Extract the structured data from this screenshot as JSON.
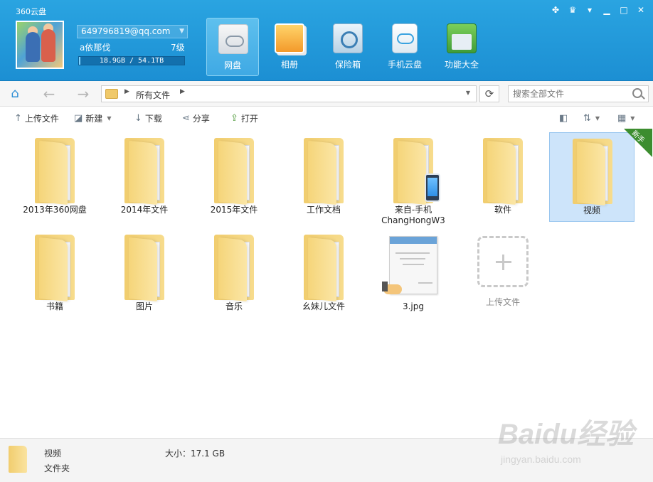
{
  "app": {
    "title": "360云盘"
  },
  "window_controls": [
    {
      "name": "gift-icon",
      "glyph": "✤"
    },
    {
      "name": "skin-icon",
      "glyph": "♛"
    },
    {
      "name": "menu-icon",
      "glyph": "▾"
    },
    {
      "name": "minimize-icon",
      "glyph": "▁"
    },
    {
      "name": "maximize-icon",
      "glyph": "□"
    },
    {
      "name": "close-icon",
      "glyph": "✕"
    }
  ],
  "user": {
    "account": "649796819@qq.com",
    "nickname": "a依那伐",
    "level": "7级",
    "quota_text": "18.9GB / 54.1TB",
    "quota_used_fraction": 0.0004
  },
  "nav_tabs": [
    {
      "id": "pan",
      "label": "网盘",
      "active": true
    },
    {
      "id": "album",
      "label": "相册",
      "active": false
    },
    {
      "id": "safe",
      "label": "保险箱",
      "active": false
    },
    {
      "id": "mobile",
      "label": "手机云盘",
      "active": false
    },
    {
      "id": "tools",
      "label": "功能大全",
      "active": false
    }
  ],
  "address": {
    "home_glyph": "⌂",
    "back_glyph": "←",
    "forward_glyph": "→",
    "crumb": "所有文件",
    "search_placeholder": "搜索全部文件"
  },
  "toolbar": {
    "upload": "上传文件",
    "new": "新建",
    "download": "下载",
    "share": "分享",
    "open": "打开"
  },
  "files": [
    {
      "name": "2013年360网盘",
      "kind": "folder"
    },
    {
      "name": "2014年文件",
      "kind": "folder"
    },
    {
      "name": "2015年文件",
      "kind": "folder"
    },
    {
      "name": "工作文档",
      "kind": "folder"
    },
    {
      "name": "来自-手机\nChangHongW3",
      "kind": "folder-phone"
    },
    {
      "name": "软件",
      "kind": "folder"
    },
    {
      "name": "视频",
      "kind": "folder",
      "selected": true
    },
    {
      "name": "书籍",
      "kind": "folder"
    },
    {
      "name": "图片",
      "kind": "folder"
    },
    {
      "name": "音乐",
      "kind": "folder"
    },
    {
      "name": "幺妹儿文件",
      "kind": "folder"
    },
    {
      "name": "3.jpg",
      "kind": "image-shared"
    },
    {
      "name": "上传文件",
      "kind": "upload"
    }
  ],
  "badge": {
    "new_label": "新手"
  },
  "status": {
    "name": "视频",
    "type": "文件夹",
    "size": "大小：17.1 GB"
  },
  "watermark": {
    "line1": "Baidu经验",
    "line2": "jingyan.baidu.com"
  },
  "colors": {
    "header": "#1c8fd3",
    "selection": "#cde4fa",
    "accent": "#2f8fd5"
  }
}
